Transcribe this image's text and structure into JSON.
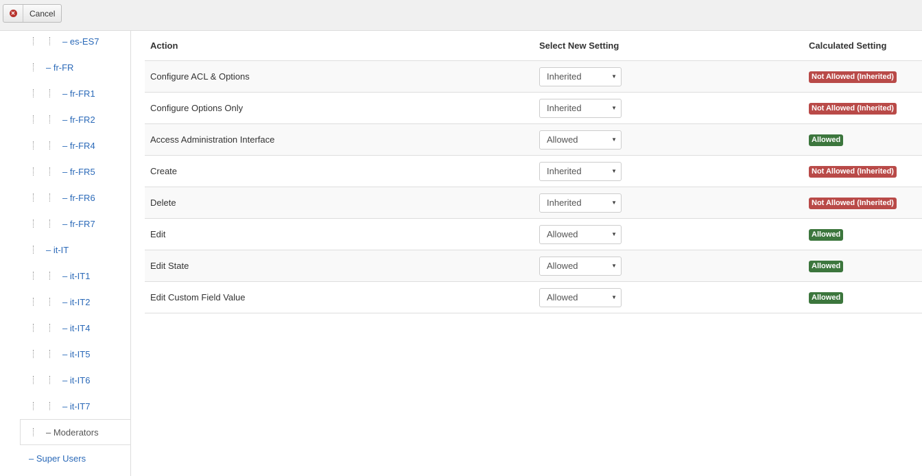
{
  "toolbar": {
    "cancel_label": "Cancel",
    "cancel_icon": "cancel-circle-icon"
  },
  "tree": [
    {
      "label": "– es-ES7",
      "depth": 2
    },
    {
      "label": "– fr-FR",
      "depth": 1
    },
    {
      "label": "– fr-FR1",
      "depth": 2
    },
    {
      "label": "– fr-FR2",
      "depth": 2
    },
    {
      "label": "– fr-FR4",
      "depth": 2
    },
    {
      "label": "– fr-FR5",
      "depth": 2
    },
    {
      "label": "– fr-FR6",
      "depth": 2
    },
    {
      "label": "– fr-FR7",
      "depth": 2
    },
    {
      "label": "– it-IT",
      "depth": 1
    },
    {
      "label": "– it-IT1",
      "depth": 2
    },
    {
      "label": "– it-IT2",
      "depth": 2
    },
    {
      "label": "– it-IT4",
      "depth": 2
    },
    {
      "label": "– it-IT5",
      "depth": 2
    },
    {
      "label": "– it-IT6",
      "depth": 2
    },
    {
      "label": "– it-IT7",
      "depth": 2
    },
    {
      "label": "– Moderators",
      "depth": 1,
      "active": true
    },
    {
      "label": "– Super Users",
      "depth": 0
    }
  ],
  "table": {
    "headers": {
      "action": "Action",
      "select": "Select New Setting",
      "calculated": "Calculated Setting"
    },
    "rows": [
      {
        "action": "Configure ACL & Options",
        "setting": "Inherited",
        "calculated": "Not Allowed (Inherited)",
        "status": "denied"
      },
      {
        "action": "Configure Options Only",
        "setting": "Inherited",
        "calculated": "Not Allowed (Inherited)",
        "status": "denied"
      },
      {
        "action": "Access Administration Interface",
        "setting": "Allowed",
        "calculated": "Allowed",
        "status": "allowed"
      },
      {
        "action": "Create",
        "setting": "Inherited",
        "calculated": "Not Allowed (Inherited)",
        "status": "denied"
      },
      {
        "action": "Delete",
        "setting": "Inherited",
        "calculated": "Not Allowed (Inherited)",
        "status": "denied"
      },
      {
        "action": "Edit",
        "setting": "Allowed",
        "calculated": "Allowed",
        "status": "allowed"
      },
      {
        "action": "Edit State",
        "setting": "Allowed",
        "calculated": "Allowed",
        "status": "allowed"
      },
      {
        "action": "Edit Custom Field Value",
        "setting": "Allowed",
        "calculated": "Allowed",
        "status": "allowed"
      }
    ]
  },
  "colors": {
    "denied": "#b94a48",
    "allowed": "#3c763d",
    "link": "#2a69b8"
  }
}
